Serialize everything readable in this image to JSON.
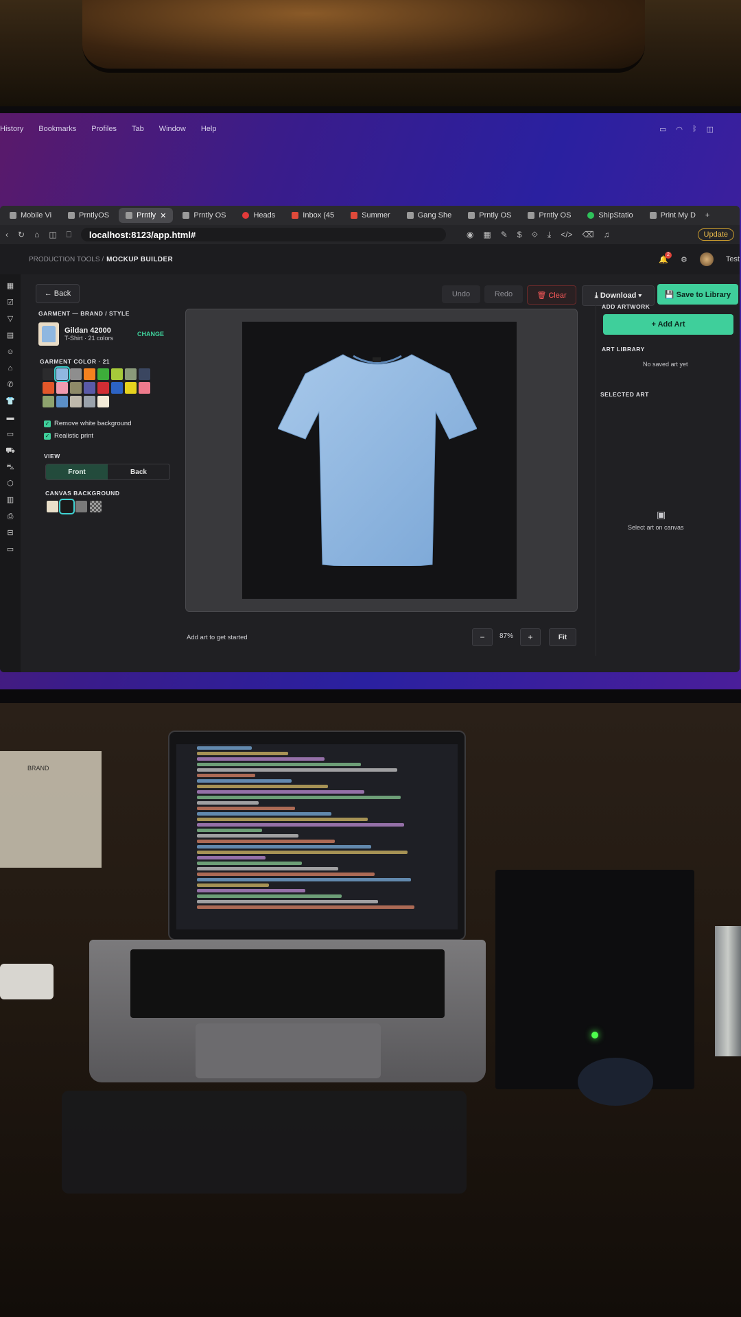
{
  "menubar": {
    "items": [
      "History",
      "Bookmarks",
      "Profiles",
      "Tab",
      "Window",
      "Help"
    ]
  },
  "tabs": [
    {
      "label": "Mobile Vi",
      "icon": "page-icon"
    },
    {
      "label": "PrntlyOS",
      "icon": "page-icon"
    },
    {
      "label": "Prntly",
      "icon": "page-icon",
      "active": true
    },
    {
      "label": "Prntly OS",
      "icon": "page-icon"
    },
    {
      "label": "Heads",
      "icon": "record-icon"
    },
    {
      "label": "Inbox (45",
      "icon": "gmail-icon"
    },
    {
      "label": "Summer",
      "icon": "gmail-icon"
    },
    {
      "label": "Gang She",
      "icon": "page-icon"
    },
    {
      "label": "Prntly OS",
      "icon": "page-icon"
    },
    {
      "label": "Prntly OS",
      "icon": "page-icon"
    },
    {
      "label": "ShipStatio",
      "icon": "shipstation-icon"
    },
    {
      "label": "Print My D",
      "icon": "page-icon"
    }
  ],
  "address": {
    "url": "localhost:8123/app.html#",
    "update_label": "Update"
  },
  "header": {
    "breadcrumb_parent": "PRODUCTION TOOLS /",
    "page_title": "MOCKUP BUILDER",
    "notification_count": "2",
    "user_name": "Test"
  },
  "toolbar": {
    "back_label": "← Back",
    "undo_label": "Undo",
    "redo_label": "Redo",
    "clear_label": "🗑 Clear",
    "download_label": "⤓ Download ▾",
    "save_label": "💾 Save to Library"
  },
  "garment": {
    "section_label": "GARMENT — BRAND / STYLE",
    "name": "Gildan 42000",
    "subtitle": "T-Shirt · 21 colors",
    "change_label": "CHANGE",
    "color_label": "GARMENT COLOR · 21",
    "colors": [
      "#2b2b2d",
      "#8fb7e0",
      "#8e8e8e",
      "#f5821f",
      "#3dae3a",
      "#a6c93a",
      "#8a9a7a",
      "#3a4660",
      "#e2572a",
      "#f19bb0",
      "#8e8a68",
      "#5a5aa8",
      "#d12d34",
      "#2c63c4",
      "#e6d21e",
      "#ef7b8c",
      "#8ea36e",
      "#5b8fc7",
      "#bfb9ac",
      "#9aa2ab",
      "#f2ead7"
    ],
    "selected_color_index": 1,
    "remove_white_label": "Remove white background",
    "realistic_print_label": "Realistic print"
  },
  "view": {
    "section_label": "VIEW",
    "front_label": "Front",
    "back_label": "Back",
    "selected": "Front"
  },
  "canvas_bg": {
    "section_label": "CANVAS BACKGROUND",
    "options": [
      "#e9dfc9",
      "#1a1a1a",
      "#7a7a7a",
      "checker"
    ],
    "selected_index": 1
  },
  "canvas": {
    "shirt_color": "#8fb7e0",
    "status_text": "Add art to get started",
    "zoom_minus": "−",
    "zoom_value": "87%",
    "zoom_plus": "+",
    "fit_label": "Fit"
  },
  "right_panel": {
    "add_artwork_label": "ADD ARTWORK",
    "add_art_button": "+ Add Art",
    "art_library_label": "ART LIBRARY",
    "no_saved_art": "No saved art yet",
    "selected_art_label": "SELECTED ART",
    "select_hint": "Select art on canvas"
  },
  "paper_sign": {
    "title": "BRAND"
  },
  "colors": {
    "accent": "#3fcf9b",
    "danger": "#ff5b5b",
    "app_bg": "#202023"
  }
}
